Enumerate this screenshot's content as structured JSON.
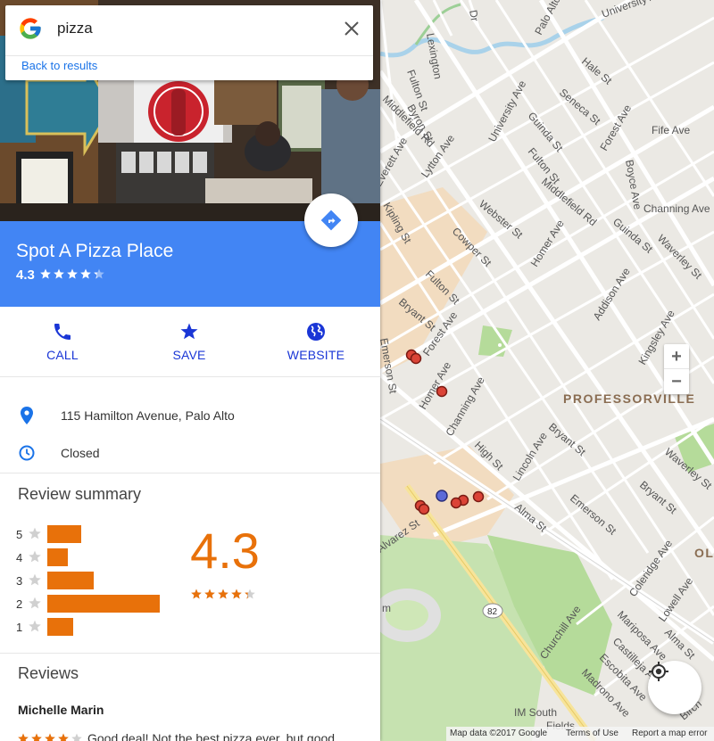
{
  "search": {
    "query": "pizza",
    "back_link": "Back to results"
  },
  "place": {
    "name": "Spot A Pizza Place",
    "rating": "4.3",
    "address": "115 Hamilton Avenue, Palo Alto",
    "hours_status": "Closed",
    "header_color": "#4285f4"
  },
  "actions": {
    "call": "CALL",
    "save": "SAVE",
    "website": "WEBSITE"
  },
  "review_summary": {
    "title": "Review summary",
    "average": "4.3",
    "average_value": 4.3,
    "distribution": [
      {
        "stars": "5",
        "share": 0.3
      },
      {
        "stars": "4",
        "share": 0.18
      },
      {
        "stars": "3",
        "share": 0.41
      },
      {
        "stars": "2",
        "share": 1.0
      },
      {
        "stars": "1",
        "share": 0.23
      }
    ],
    "bar_color": "#e8710a"
  },
  "reviews": {
    "title": "Reviews",
    "first": {
      "author": "Michelle Marin",
      "stars": 4,
      "snippet": "Good deal! Not the best pizza ever, but good..."
    }
  },
  "map": {
    "streets": [
      "University Ave",
      "Palo Alto",
      "Lexington",
      "Dr",
      "Fulton St",
      "Middlefield Rd",
      "Byron St",
      "Seneca St",
      "Hale St",
      "Everett Ave",
      "Lytton Ave",
      "University Ave",
      "Guinda St",
      "Fulton St",
      "Forest Ave",
      "Fife Ave",
      "Boyce Ave",
      "Middlefield Rd",
      "Webster St",
      "Kipling St",
      "Cowper St",
      "Channing Ave",
      "Homer Ave",
      "Guinda St",
      "Waverley St",
      "Fulton St",
      "Addison Ave",
      "Bryant St",
      "Forest Ave",
      "Kingsley Ave",
      "Emerson St",
      "Homer Ave",
      "Channing Ave",
      "High St",
      "Bryant St",
      "Lincoln Ave",
      "Alma St",
      "Emerson St",
      "Waverley St",
      "Bryant St",
      "Coleridge Ave",
      "Lowell Ave",
      "Alvarez St",
      "Mariposa Ave",
      "Churchill Ave",
      "Castilleja Ave",
      "Escobita Ave",
      "Madrono Ave",
      "Alma St",
      "Birch"
    ],
    "area_label": "PROFESSORVILLE",
    "area_label_2": "OL",
    "place_labels": [
      "IM South",
      "Fields",
      "m"
    ],
    "route_number": "82",
    "footer": {
      "map_data": "Map data ©2017 Google",
      "terms": "Terms of Use",
      "report": "Report a map error"
    }
  }
}
